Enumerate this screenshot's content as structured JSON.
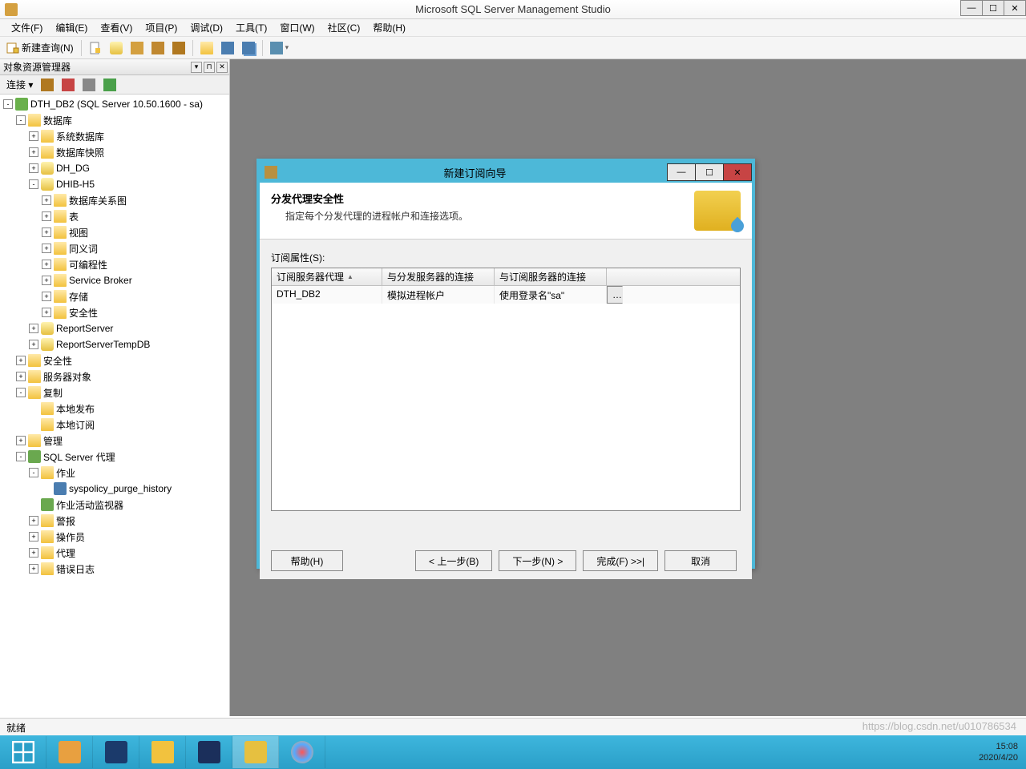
{
  "title": "Microsoft SQL Server Management Studio",
  "menubar": [
    "文件(F)",
    "编辑(E)",
    "查看(V)",
    "项目(P)",
    "调试(D)",
    "工具(T)",
    "窗口(W)",
    "社区(C)",
    "帮助(H)"
  ],
  "toolbar": {
    "new_query": "新建查询(N)"
  },
  "sidebar": {
    "title": "对象资源管理器",
    "connect_label": "连接 ▾",
    "root": "DTH_DB2 (SQL Server 10.50.1600 - sa)",
    "database": "数据库",
    "sys_db": "系统数据库",
    "db_snapshot": "数据库快照",
    "dh_dg": "DH_DG",
    "dhib": "DHIB-H5",
    "dhib_children": [
      "数据库关系图",
      "表",
      "视图",
      "同义词",
      "可编程性",
      "Service Broker",
      "存储",
      "安全性"
    ],
    "report_server": "ReportServer",
    "report_server_temp": "ReportServerTempDB",
    "security": "安全性",
    "server_objects": "服务器对象",
    "replication": "复制",
    "local_pub": "本地发布",
    "local_sub": "本地订阅",
    "management": "管理",
    "agent": "SQL Server 代理",
    "jobs": "作业",
    "job_item": "syspolicy_purge_history",
    "job_monitor": "作业活动监视器",
    "alerts": "警报",
    "operators": "操作员",
    "proxies": "代理",
    "error_logs": "错误日志"
  },
  "dialog": {
    "title": "新建订阅向导",
    "heading": "分发代理安全性",
    "desc": "指定每个分发代理的进程帐户和连接选项。",
    "props_label": "订阅属性(S):",
    "columns": [
      "订阅服务器代理",
      "与分发服务器的连接",
      "与订阅服务器的连接"
    ],
    "row": [
      "DTH_DB2",
      "模拟进程帐户",
      "使用登录名\"sa\""
    ],
    "buttons": {
      "help": "帮助(H)",
      "back": "< 上一步(B)",
      "next": "下一步(N) >",
      "finish": "完成(F) >>|",
      "cancel": "取消"
    }
  },
  "statusbar": "就绪",
  "watermark": "https://blog.csdn.net/u010786534",
  "clock": {
    "time": "15:08",
    "date": "2020/4/20"
  }
}
